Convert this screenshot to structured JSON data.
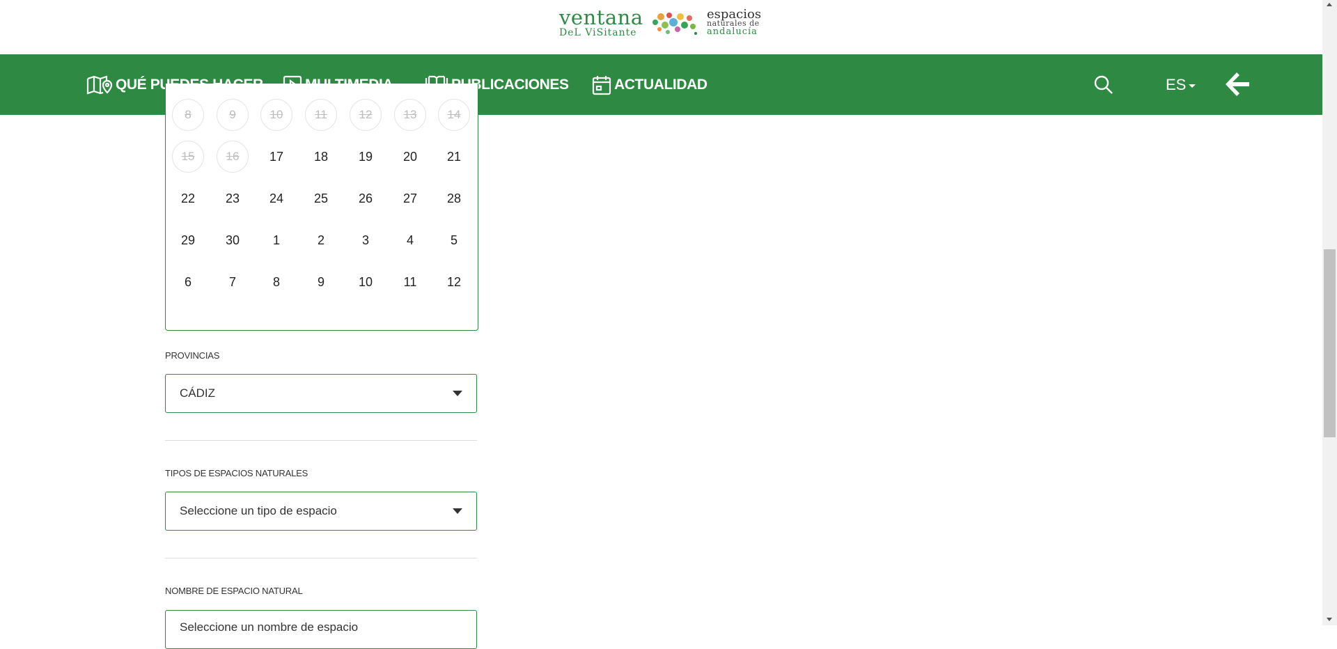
{
  "brand": {
    "logo_line1": "ventana",
    "logo_line2": "DeL ViSitante",
    "logo_right_line1": "espacios",
    "logo_right_line2": "naturales de",
    "logo_right_line3": "andalucía"
  },
  "nav": {
    "items": [
      {
        "label": "QUÉ PUEDES HACER",
        "icon": "map-pin-icon"
      },
      {
        "label": "MULTIMEDIA",
        "icon": "play-icon"
      },
      {
        "label": "PUBLICACIONES",
        "icon": "book-icon"
      },
      {
        "label": "ACTUALIDAD",
        "icon": "calendar-icon"
      }
    ],
    "search_icon": "search-icon",
    "language": "ES",
    "back_icon": "arrow-left-icon"
  },
  "calendar": {
    "weeks": [
      [
        {
          "d": "8",
          "disabled": true
        },
        {
          "d": "9",
          "disabled": true
        },
        {
          "d": "10",
          "disabled": true
        },
        {
          "d": "11",
          "disabled": true
        },
        {
          "d": "12",
          "disabled": true
        },
        {
          "d": "13",
          "disabled": true
        },
        {
          "d": "14",
          "disabled": true
        }
      ],
      [
        {
          "d": "15",
          "disabled": true
        },
        {
          "d": "16",
          "disabled": true
        },
        {
          "d": "17",
          "disabled": false
        },
        {
          "d": "18",
          "disabled": false
        },
        {
          "d": "19",
          "disabled": false
        },
        {
          "d": "20",
          "disabled": false
        },
        {
          "d": "21",
          "disabled": false
        }
      ],
      [
        {
          "d": "22",
          "disabled": false
        },
        {
          "d": "23",
          "disabled": false
        },
        {
          "d": "24",
          "disabled": false
        },
        {
          "d": "25",
          "disabled": false
        },
        {
          "d": "26",
          "disabled": false
        },
        {
          "d": "27",
          "disabled": false
        },
        {
          "d": "28",
          "disabled": false
        }
      ],
      [
        {
          "d": "29",
          "disabled": false
        },
        {
          "d": "30",
          "disabled": false
        },
        {
          "d": "1",
          "disabled": false
        },
        {
          "d": "2",
          "disabled": false
        },
        {
          "d": "3",
          "disabled": false
        },
        {
          "d": "4",
          "disabled": false
        },
        {
          "d": "5",
          "disabled": false
        }
      ],
      [
        {
          "d": "6",
          "disabled": false
        },
        {
          "d": "7",
          "disabled": false
        },
        {
          "d": "8",
          "disabled": false
        },
        {
          "d": "9",
          "disabled": false
        },
        {
          "d": "10",
          "disabled": false
        },
        {
          "d": "11",
          "disabled": false
        },
        {
          "d": "12",
          "disabled": false
        }
      ]
    ]
  },
  "filters": {
    "provincias_label": "PROVINCIAS",
    "provincias_value": "CÁDIZ",
    "tipos_label": "TIPOS DE ESPACIOS NATURALES",
    "tipos_placeholder": "Seleccione un tipo de espacio",
    "nombre_label": "NOMBRE DE ESPACIO NATURAL",
    "nombre_placeholder": "Seleccione un nombre de espacio"
  },
  "colors": {
    "brand_green": "#2e8943",
    "disabled_day": "#bdbdbd"
  }
}
